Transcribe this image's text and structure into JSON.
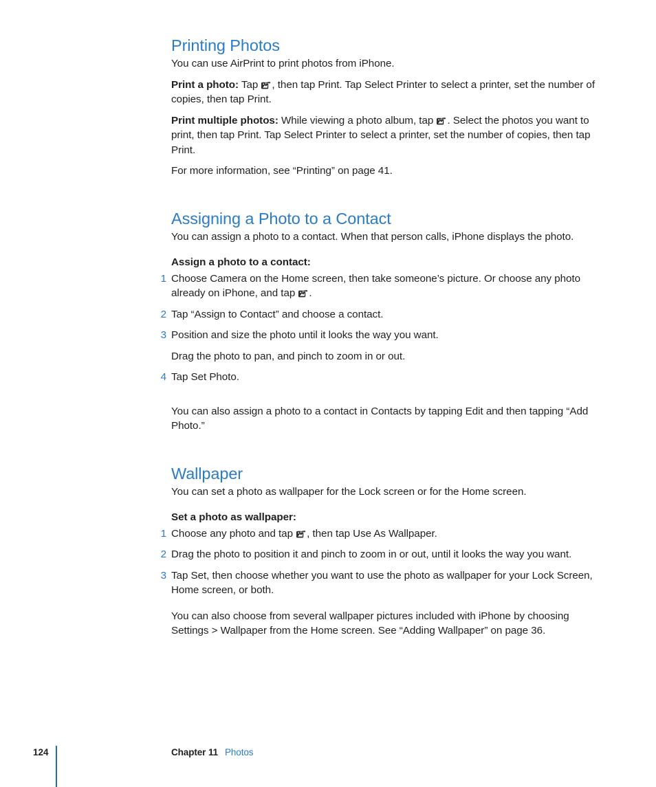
{
  "document": {
    "page_number": "124",
    "footer_chapter": "Chapter 11",
    "footer_topic": "Photos",
    "accent_blue": "#2b7cc4",
    "rule_blue": "#1f6fb2",
    "text_color": "#231f20"
  },
  "sections": [
    {
      "title": "Printing Photos",
      "lead": "You can use AirPrint to print photos from iPhone.",
      "paragraphs": [
        {
          "run_in": "Print a photo:",
          "before_icon": " Tap ",
          "icon": "share-icon",
          "after_icon": ", then tap Print. Tap Select Printer to select a printer, set the number of copies, then tap Print."
        },
        {
          "run_in": "Print multiple photos:",
          "before_icon": " While viewing a photo album, tap ",
          "icon": "share-icon",
          "after_icon": ". Select the photos you want to print, then tap Print. Tap Select Printer to select a printer, set the number of copies, then tap Print."
        }
      ],
      "closing": "For more information, see “Printing” on page 41."
    },
    {
      "title": "Assigning a Photo to a Contact",
      "lead": "You can assign a photo to a contact. When that person calls, iPhone displays the photo.",
      "task_heading": "Assign a photo to a contact:",
      "steps": [
        {
          "num": "1",
          "before_icon": "Choose Camera on the Home screen, then take someone’s picture. Or choose any photo already on iPhone, and tap ",
          "icon": "share-icon",
          "after_icon": "."
        },
        {
          "num": "2",
          "text": "Tap “Assign to Contact” and choose a contact."
        },
        {
          "num": "3",
          "text": "Position and size the photo until it looks the way you want."
        },
        {
          "num": "",
          "text": "Drag the photo to pan, and pinch to zoom in or out.",
          "unnumbered": true
        },
        {
          "num": "4",
          "text": "Tap Set Photo."
        }
      ],
      "closing": "You can also assign a photo to a contact in Contacts by tapping Edit and then tapping “Add Photo.”"
    },
    {
      "title": "Wallpaper",
      "lead": "You can set a photo as wallpaper for the Lock screen or for the Home screen.",
      "task_heading": "Set a photo as wallpaper:",
      "steps": [
        {
          "num": "1",
          "before_icon": "Choose any photo and tap ",
          "icon": "share-icon",
          "after_icon": ", then tap Use As Wallpaper."
        },
        {
          "num": "2",
          "text": "Drag the photo to position it and pinch to zoom in or out, until it looks the way you want."
        },
        {
          "num": "3",
          "text": "Tap Set, then choose whether you want to use the photo as wallpaper for your Lock Screen, Home screen, or both."
        }
      ],
      "closing": "You can also choose from several wallpaper pictures included with iPhone by choosing Settings > Wallpaper from the Home screen. See “Adding Wallpaper” on page 36."
    }
  ]
}
